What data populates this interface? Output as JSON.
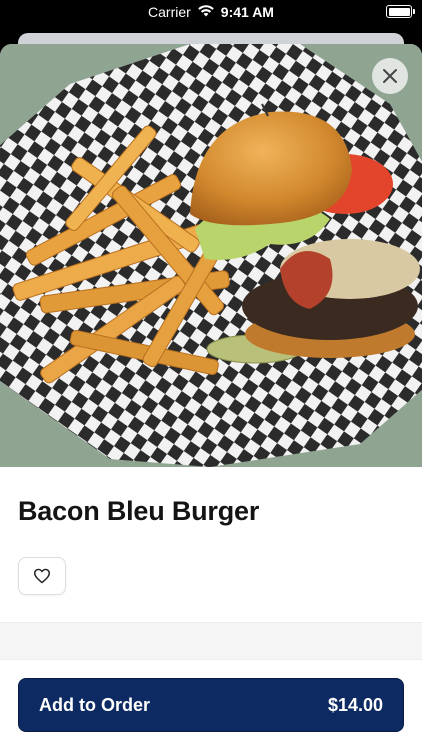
{
  "status_bar": {
    "carrier": "Carrier",
    "time": "9:41 AM"
  },
  "item": {
    "name": "Bacon Bleu Burger",
    "image_icon": "burger-photo"
  },
  "actions": {
    "close_icon": "close-icon",
    "favorite_icon": "heart-icon"
  },
  "order_button": {
    "label": "Add to Order",
    "price": "$14.00"
  },
  "colors": {
    "primary": "#0d2a63",
    "background": "#ffffff",
    "divider": "#f5f5f5"
  }
}
